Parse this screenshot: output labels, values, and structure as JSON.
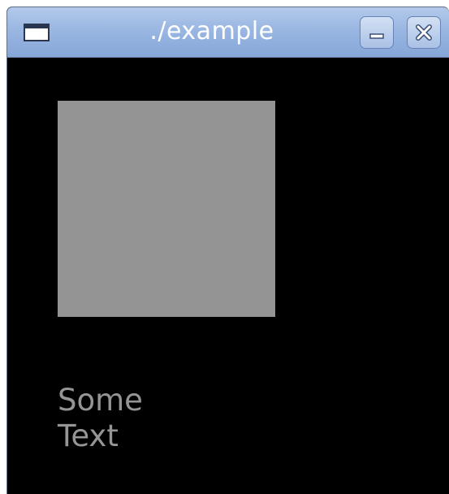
{
  "window": {
    "title": "./example",
    "icons": {
      "app": "window-icon",
      "minimize": "minimize-icon",
      "close": "close-icon"
    }
  },
  "canvas": {
    "text_line1": "Some",
    "text_line2": "Text",
    "colors": {
      "background": "#000000",
      "square": "#949494",
      "text": "#959595"
    }
  }
}
